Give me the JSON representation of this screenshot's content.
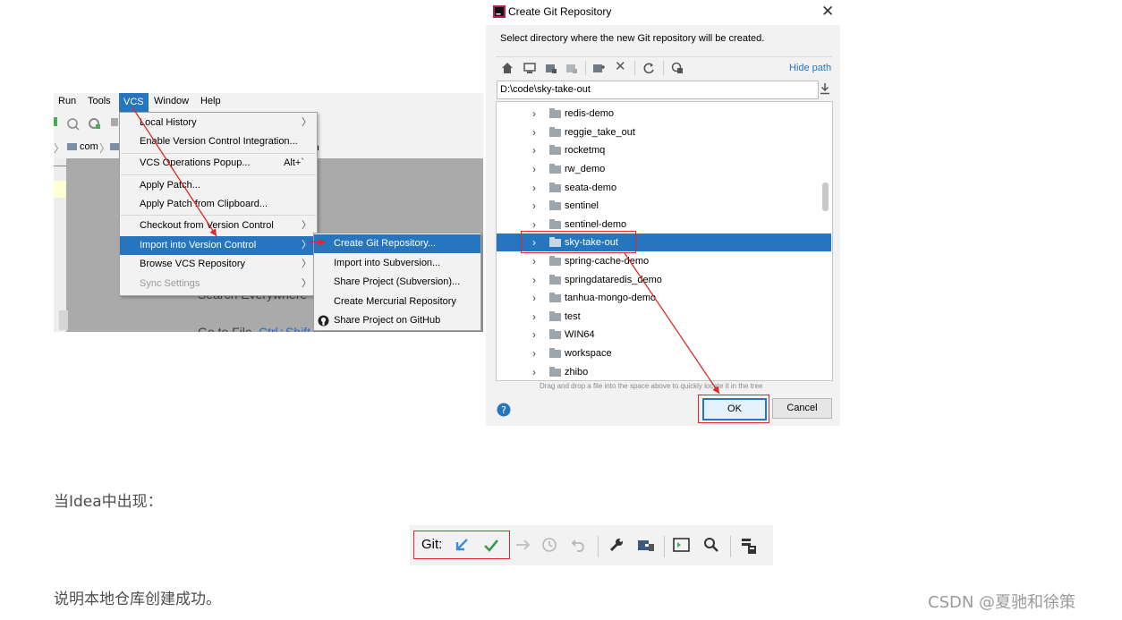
{
  "ide": {
    "menubar": [
      "Run",
      "Tools",
      "VCS",
      "Window",
      "Help"
    ],
    "menubar_active": "VCS",
    "nav_breadcrumb": "com",
    "vcs_menu": [
      {
        "label": "Local History",
        "submenu": true
      },
      {
        "label": "Enable Version Control Integration..."
      },
      {
        "label": "VCS Operations Popup...",
        "shortcut": "Alt+`"
      },
      {
        "label": "Apply Patch..."
      },
      {
        "label": "Apply Patch from Clipboard..."
      },
      {
        "label": "Checkout from Version Control",
        "submenu": true
      },
      {
        "label": "Import into Version Control",
        "submenu": true,
        "selected": true
      },
      {
        "label": "Browse VCS Repository",
        "submenu": true
      },
      {
        "label": "Sync Settings",
        "submenu": true,
        "disabled": true
      }
    ],
    "import_submenu": [
      {
        "label": "Create Git Repository...",
        "selected": true
      },
      {
        "label": "Import into Subversion..."
      },
      {
        "label": "Share Project (Subversion)..."
      },
      {
        "label": "Create Mercurial Repository"
      },
      {
        "label": "Share Project on GitHub",
        "icon": "github-icon"
      }
    ],
    "background_hint_1": "Search Everywhere",
    "background_hint_2": "Go to File",
    "background_hint_2_shortcut": "Ctrl+Shift+..."
  },
  "dialog": {
    "title": "Create Git Repository",
    "description": "Select directory where the new Git repository will be created.",
    "hide_path": "Hide path",
    "path_value": "D:\\code\\sky-take-out",
    "tree": [
      "redis-demo",
      "reggie_take_out",
      "rocketmq",
      "rw_demo",
      "seata-demo",
      "sentinel",
      "sentinel-demo",
      "sky-take-out",
      "spring-cache-demo",
      "springdataredis_demo",
      "tanhua-mongo-demo",
      "test",
      "WIN64",
      "workspace",
      "zhibo"
    ],
    "selected_item": "sky-take-out",
    "drag_hint": "Drag and drop a file into the space above to quickly locate it in the tree",
    "ok": "OK",
    "cancel": "Cancel"
  },
  "text_line_1": "当Idea中出现：",
  "gitbar": {
    "label": "Git:"
  },
  "text_line_2": "说明本地仓库创建成功。",
  "watermark": "CSDN @夏驰和徐策",
  "colors": {
    "accent": "#2675bf",
    "highlight_red": "#e0282b",
    "git_update": "#3f8fd8",
    "git_commit": "#3c9a55"
  }
}
